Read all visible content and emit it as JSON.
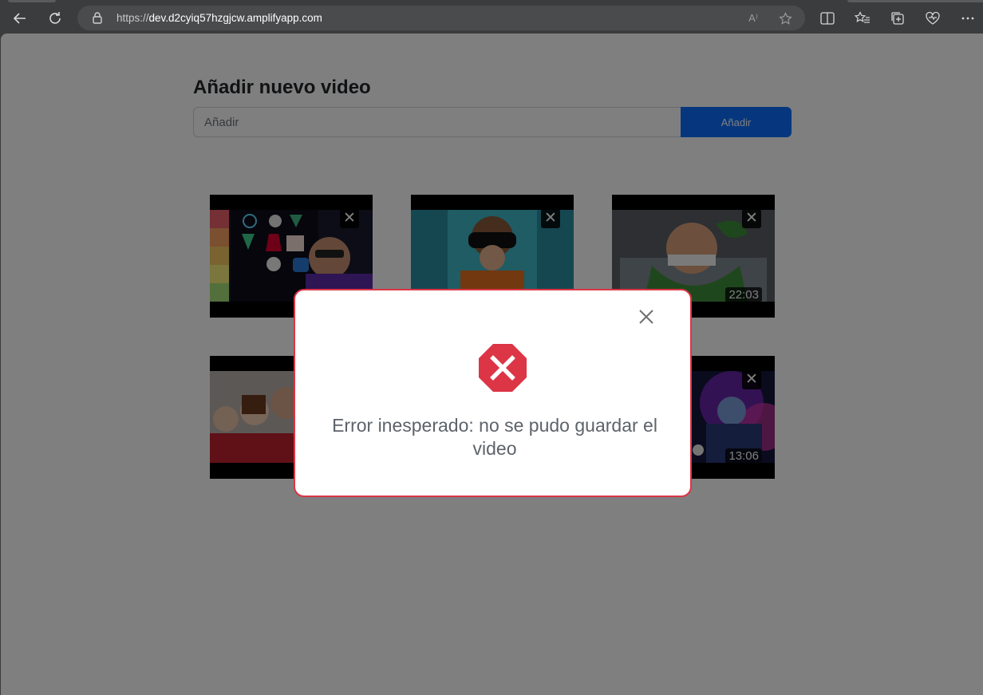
{
  "browser": {
    "url_scheme": "https://",
    "url_host": "dev.d2cyiq57hzgjcw.amplifyapp.com",
    "read_aloud_glyph": "A⁾"
  },
  "page": {
    "title": "Añadir nuevo video",
    "input_placeholder": "Añadir",
    "add_button_label": "Añadir"
  },
  "videos": [
    {
      "duration": "",
      "remove_label": "✕"
    },
    {
      "duration": "",
      "remove_label": "✕"
    },
    {
      "duration": "22:03",
      "remove_label": "✕"
    },
    {
      "duration": "",
      "remove_label": "✕"
    },
    {
      "duration": "",
      "remove_label": "✕"
    },
    {
      "duration": "13:06",
      "remove_label": "✕"
    }
  ],
  "modal": {
    "message": "Error inesperado: no se pudo guardar el video",
    "accent": "#dc3545"
  }
}
